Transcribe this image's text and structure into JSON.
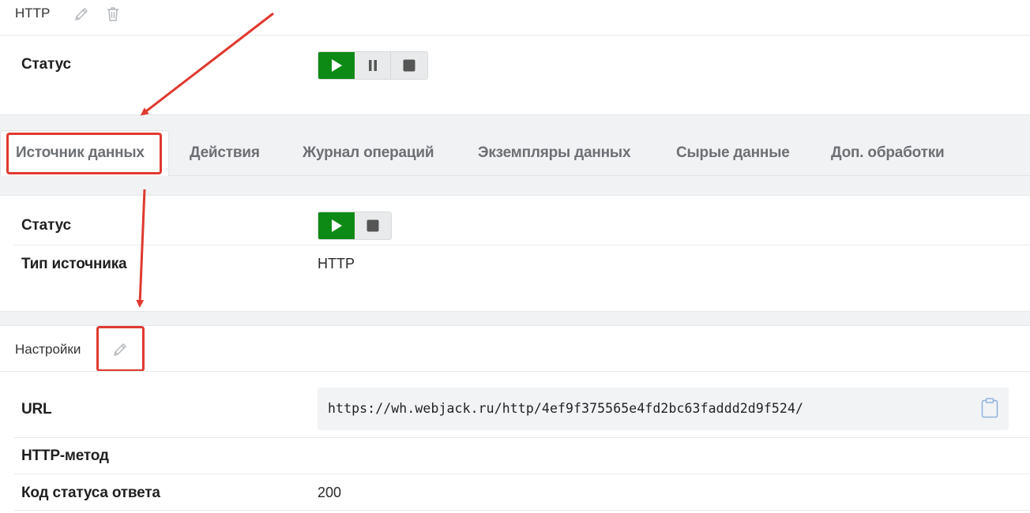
{
  "header": {
    "title": "HTTP",
    "edit_icon": "pencil-icon",
    "delete_icon": "trash-icon"
  },
  "main_status": {
    "label": "Статус",
    "controls": [
      "play-icon",
      "pause-icon",
      "stop-icon"
    ],
    "active": "play"
  },
  "tabs": [
    {
      "label": "Источник данных",
      "active": true
    },
    {
      "label": "Действия"
    },
    {
      "label": "Журнал операций"
    },
    {
      "label": "Экземпляры данных"
    },
    {
      "label": "Сырые данные"
    },
    {
      "label": "Доп. обработки"
    }
  ],
  "source": {
    "status_label": "Статус",
    "controls": [
      "play-icon",
      "stop-icon"
    ],
    "type_label": "Тип источника",
    "type_value": "HTTP"
  },
  "settings": {
    "title": "Настройки",
    "edit_icon": "pencil-icon",
    "fields": [
      {
        "label": "URL",
        "value": "https://wh.webjack.ru/http/4ef9f375565e4fd2bc63faddd2d9f524/"
      },
      {
        "label": "HTTP-метод",
        "value": ""
      },
      {
        "label": "Код статуса ответа",
        "value": "200"
      }
    ],
    "copy_icon": "clipboard-icon"
  },
  "colors": {
    "accent_green": "#0d8a16",
    "annotation_red": "#e0392f",
    "band_bg": "#f1f2f4"
  }
}
